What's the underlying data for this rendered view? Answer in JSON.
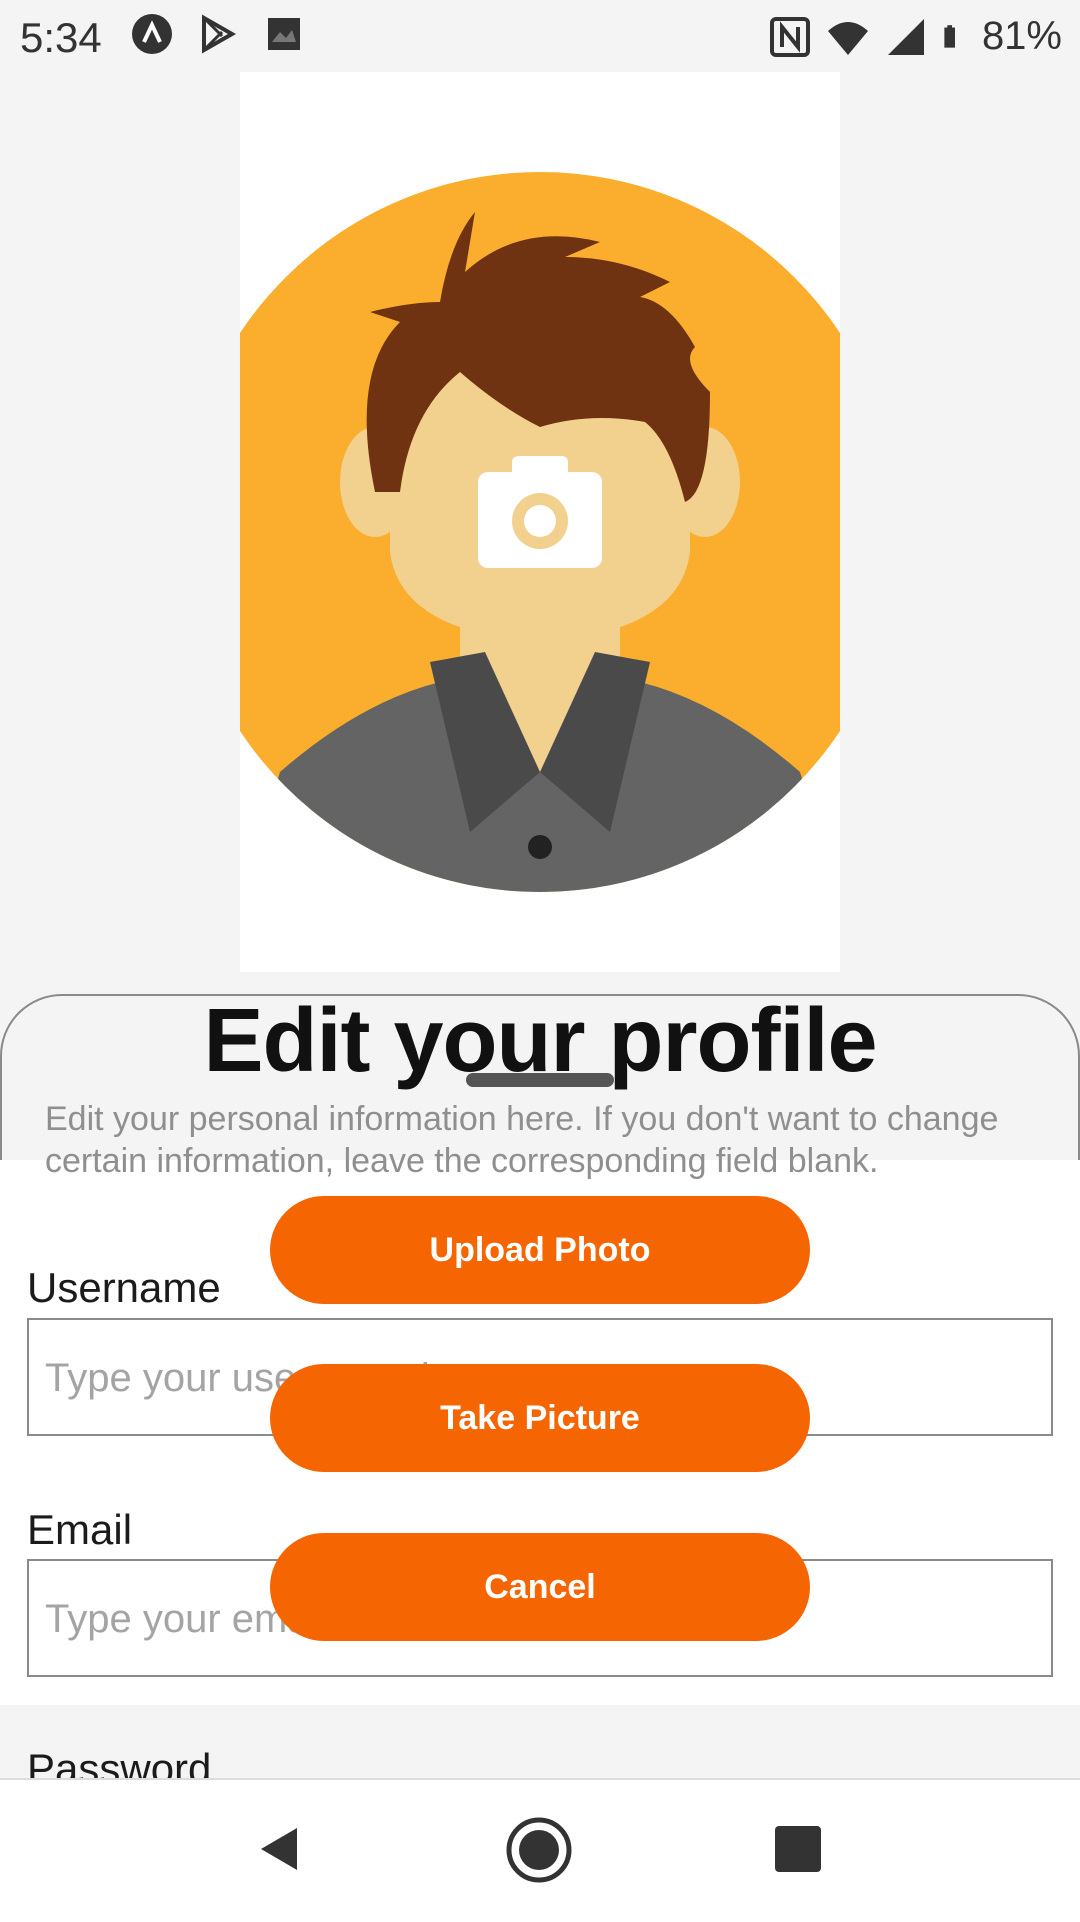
{
  "status_bar": {
    "time": "5:34",
    "battery": "81%",
    "icons_left": [
      "navigation-arrow-icon",
      "play-store-icon",
      "photo-icon"
    ],
    "icons_right": [
      "nfc-icon",
      "wifi-icon",
      "signal-icon",
      "battery-icon"
    ]
  },
  "header": {
    "title": "Edit your profile",
    "description": "Edit your personal information here. If you don't want to change certain information, leave the corresponding field blank."
  },
  "form": {
    "username": {
      "label": "Username",
      "placeholder": "Type your username here"
    },
    "email": {
      "label": "Email",
      "placeholder": "Type your email here"
    },
    "password": {
      "label": "Password"
    }
  },
  "actions": {
    "upload_photo": "Upload Photo",
    "take_picture": "Take Picture",
    "cancel": "Cancel"
  },
  "colors": {
    "accent": "#f56502",
    "avatar_bg": "#fbae2d",
    "hair": "#6f3311",
    "skin": "#f2d08e",
    "shirt": "#646464"
  },
  "nav": {
    "icons": [
      "back-icon",
      "home-icon",
      "recents-icon"
    ]
  }
}
